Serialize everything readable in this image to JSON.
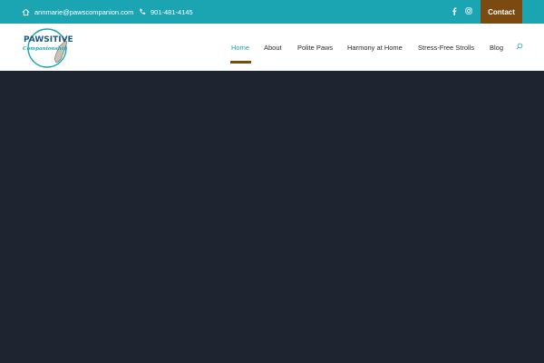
{
  "topbar": {
    "email": "annmarie@pawscompanion.com",
    "phone": "901-481-4145",
    "contact_label": "Contact",
    "icons": [
      "home-icon",
      "phone-icon",
      "facebook-icon",
      "instagram-icon"
    ]
  },
  "logo": {
    "line1": "PAWSITIVE",
    "line2": "Companionship"
  },
  "nav": {
    "items": [
      {
        "label": "Home",
        "active": true
      },
      {
        "label": "About"
      },
      {
        "label": "Polite Paws"
      },
      {
        "label": "Harmony at Home"
      },
      {
        "label": "Stress-Free Strolls"
      },
      {
        "label": "Blog"
      }
    ],
    "search_icon": "search-icon"
  },
  "colors": {
    "topbar_bg": "#1ba5b2",
    "accent": "#7a4a10",
    "hero_bg": "#1f2530",
    "nav_active": "#1ba5b2"
  }
}
